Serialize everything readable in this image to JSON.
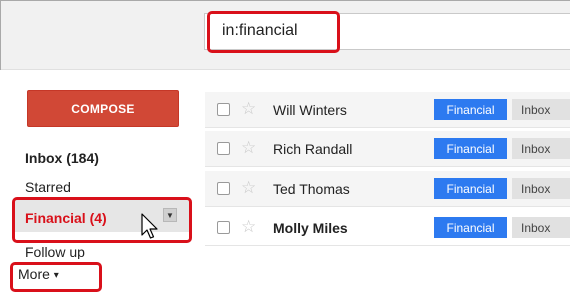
{
  "search": {
    "value": "in:financial"
  },
  "compose": {
    "label": "COMPOSE"
  },
  "nav": {
    "inbox": "Inbox (184)",
    "starred": "Starred",
    "financial": "Financial (4)",
    "follow_up": "Follow up",
    "more": "More",
    "more_caret": "▾",
    "dropdown_glyph": "▼"
  },
  "emails": [
    {
      "sender": "Will Winters",
      "label": "Financial",
      "folder": "Inbox",
      "unread": false
    },
    {
      "sender": "Rich Randall",
      "label": "Financial",
      "folder": "Inbox",
      "unread": false
    },
    {
      "sender": "Ted Thomas",
      "label": "Financial",
      "folder": "Inbox",
      "unread": false
    },
    {
      "sender": "Molly Miles",
      "label": "Financial",
      "folder": "Inbox",
      "unread": true
    }
  ],
  "icons": {
    "star": "☆"
  },
  "colors": {
    "compose_bg": "#d14836",
    "highlight": "#d9101a",
    "label_financial": "#2d7af0",
    "label_inbox": "#e1e1e1"
  }
}
